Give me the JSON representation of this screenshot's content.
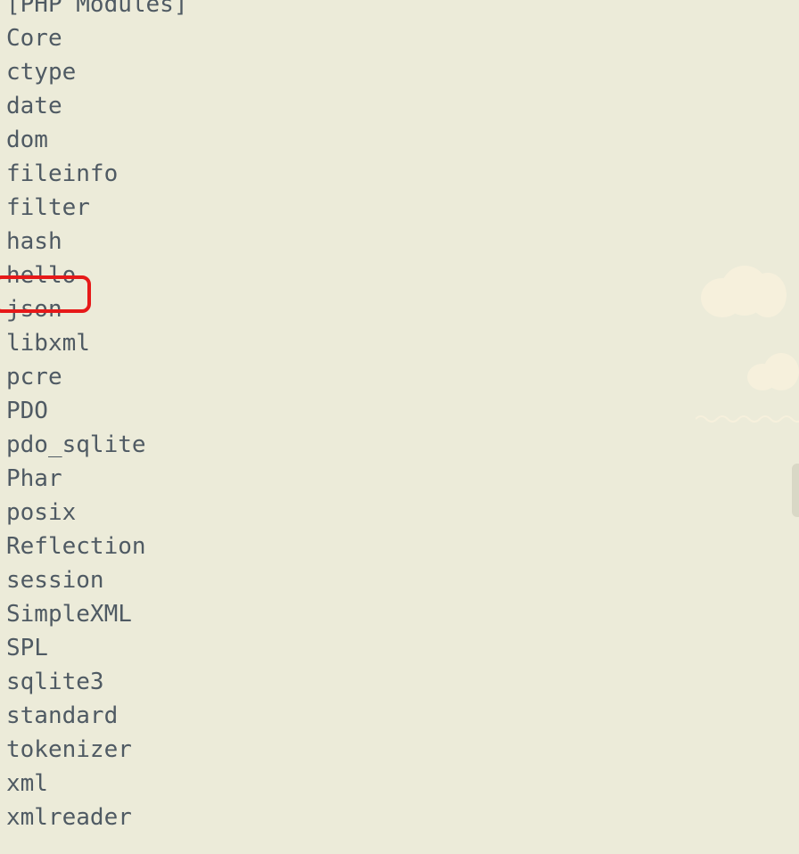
{
  "terminal": {
    "partial_top_line": "",
    "lines": [
      "[PHP Modules]",
      "Core",
      "ctype",
      "date",
      "dom",
      "fileinfo",
      "filter",
      "hash",
      "hello",
      "json",
      "libxml",
      "pcre",
      "PDO",
      "pdo_sqlite",
      "Phar",
      "posix",
      "Reflection",
      "session",
      "SimpleXML",
      "SPL",
      "sqlite3",
      "standard",
      "tokenizer",
      "xml",
      "xmlreader"
    ],
    "highlighted_line": "hello"
  },
  "colors": {
    "background": "#ecebd9",
    "text": "#4f5a63",
    "highlight_border": "#e61919",
    "cloud": "#f6f0dc"
  }
}
